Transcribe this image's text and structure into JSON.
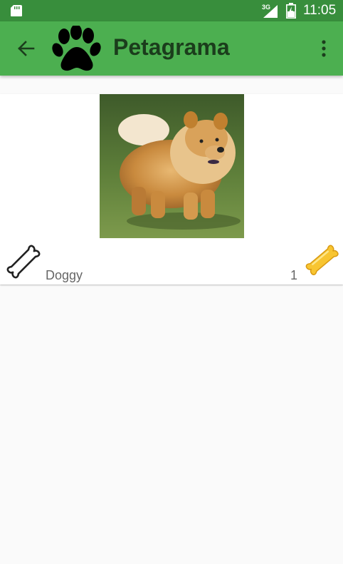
{
  "status_bar": {
    "time": "11:05",
    "network_label": "3G",
    "icons": [
      "sd-card-icon",
      "signal-icon",
      "battery-icon"
    ]
  },
  "app_bar": {
    "title": "Petagrama",
    "icons": [
      "back-arrow-icon",
      "paw-icon",
      "overflow-menu-icon"
    ]
  },
  "pet_card": {
    "name": "Doggy",
    "likes": "1",
    "icons": [
      "bone-outline-icon",
      "bone-gold-icon"
    ],
    "photo": "dog-photo"
  },
  "colors": {
    "status_bar": "#388e3c",
    "app_bar": "#4caf50",
    "title": "#1b3d1c",
    "bone_gold": "#f8c531"
  }
}
